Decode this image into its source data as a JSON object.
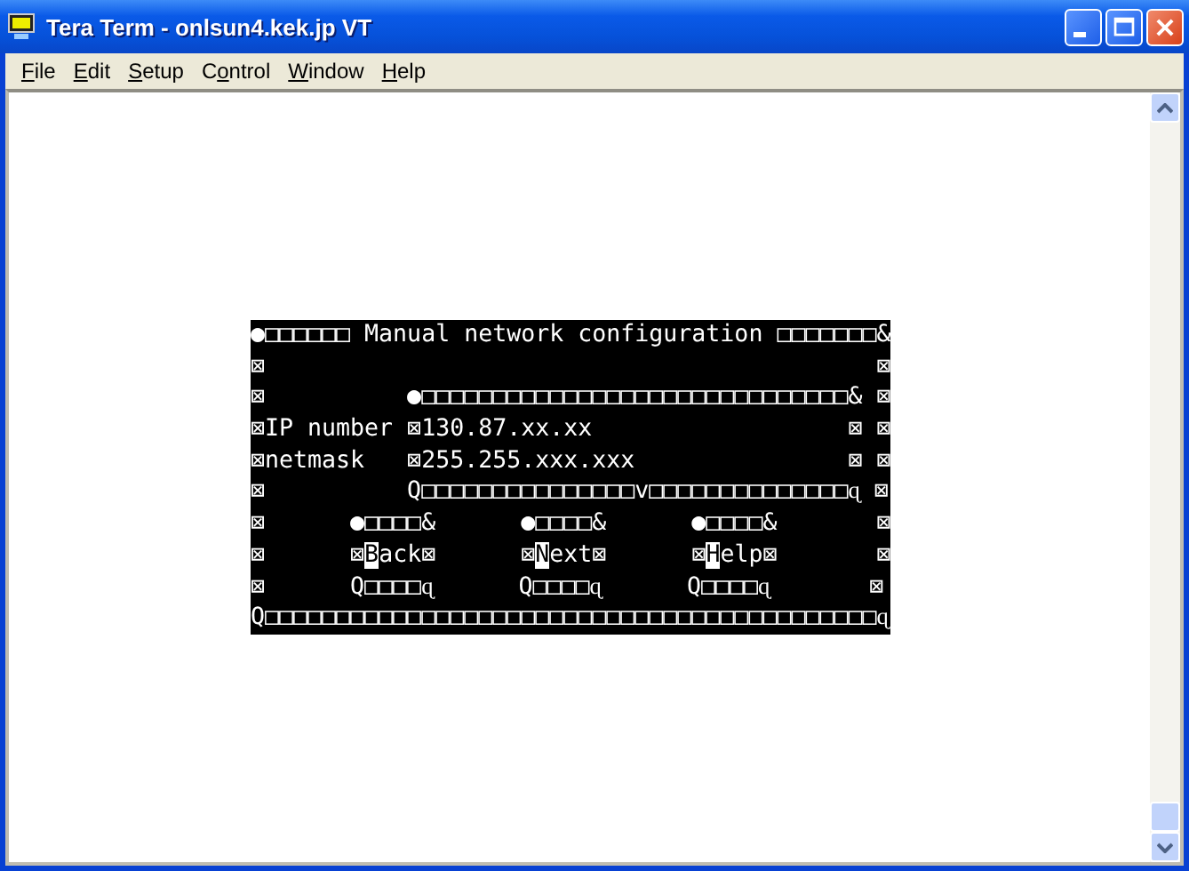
{
  "window": {
    "title": "Tera Term - onlsun4.kek.jp VT"
  },
  "menu": [
    {
      "key": "F",
      "after": "ile"
    },
    {
      "key": "E",
      "after": "dit"
    },
    {
      "key": "S",
      "after": "etup"
    },
    {
      "before": "C",
      "key": "o",
      "after": "ntrol"
    },
    {
      "key": "W",
      "after": "indow"
    },
    {
      "key": "H",
      "after": "elp"
    }
  ],
  "terminal": {
    "lines": [
      {
        "segments": [
          {
            "text": "●□□□□□□ Manual network configuration □□□□□□□&",
            "inverse": false
          }
        ]
      },
      {
        "segments": [
          {
            "text": "⊠                                           ⊠",
            "inverse": false
          }
        ]
      },
      {
        "segments": [
          {
            "text": "⊠          ●□□□□□□□□□□□□□□□□□□□□□□□□□□□□□□& ⊠",
            "inverse": false
          }
        ]
      },
      {
        "segments": [
          {
            "text": "⊠IP number ⊠130.87.xx.xx                  ⊠ ⊠",
            "inverse": false
          }
        ]
      },
      {
        "segments": [
          {
            "text": "⊠netmask   ⊠255.255.xxx.xxx               ⊠ ⊠",
            "inverse": false
          }
        ]
      },
      {
        "segments": [
          {
            "text": "⊠          Q□□□□□□□□□□□□□□□v□□□□□□□□□□□□□□ɋ ⊠",
            "inverse": false
          }
        ]
      },
      {
        "segments": [
          {
            "text": "⊠      ●□□□□&      ●□□□□&      ●□□□□&       ⊠",
            "inverse": false
          }
        ]
      },
      {
        "segments": [
          {
            "text": "⊠      ⊠",
            "inverse": false
          },
          {
            "text": "B",
            "inverse": true
          },
          {
            "text": "ack⊠      ⊠",
            "inverse": false
          },
          {
            "text": "N",
            "inverse": true
          },
          {
            "text": "ext⊠      ⊠",
            "inverse": false
          },
          {
            "text": "H",
            "inverse": true
          },
          {
            "text": "elp⊠       ⊠",
            "inverse": false
          }
        ]
      },
      {
        "segments": [
          {
            "text": "⊠      Q□□□□ɋ      Q□□□□ɋ      Q□□□□ɋ       ⊠",
            "inverse": false
          }
        ]
      },
      {
        "segments": [
          {
            "text": "Q□□□□□□□□□□□□□□□□□□□□□□□□□□□□□□□□□□□□□□□□□□□ɋ",
            "inverse": false
          }
        ]
      }
    ]
  }
}
